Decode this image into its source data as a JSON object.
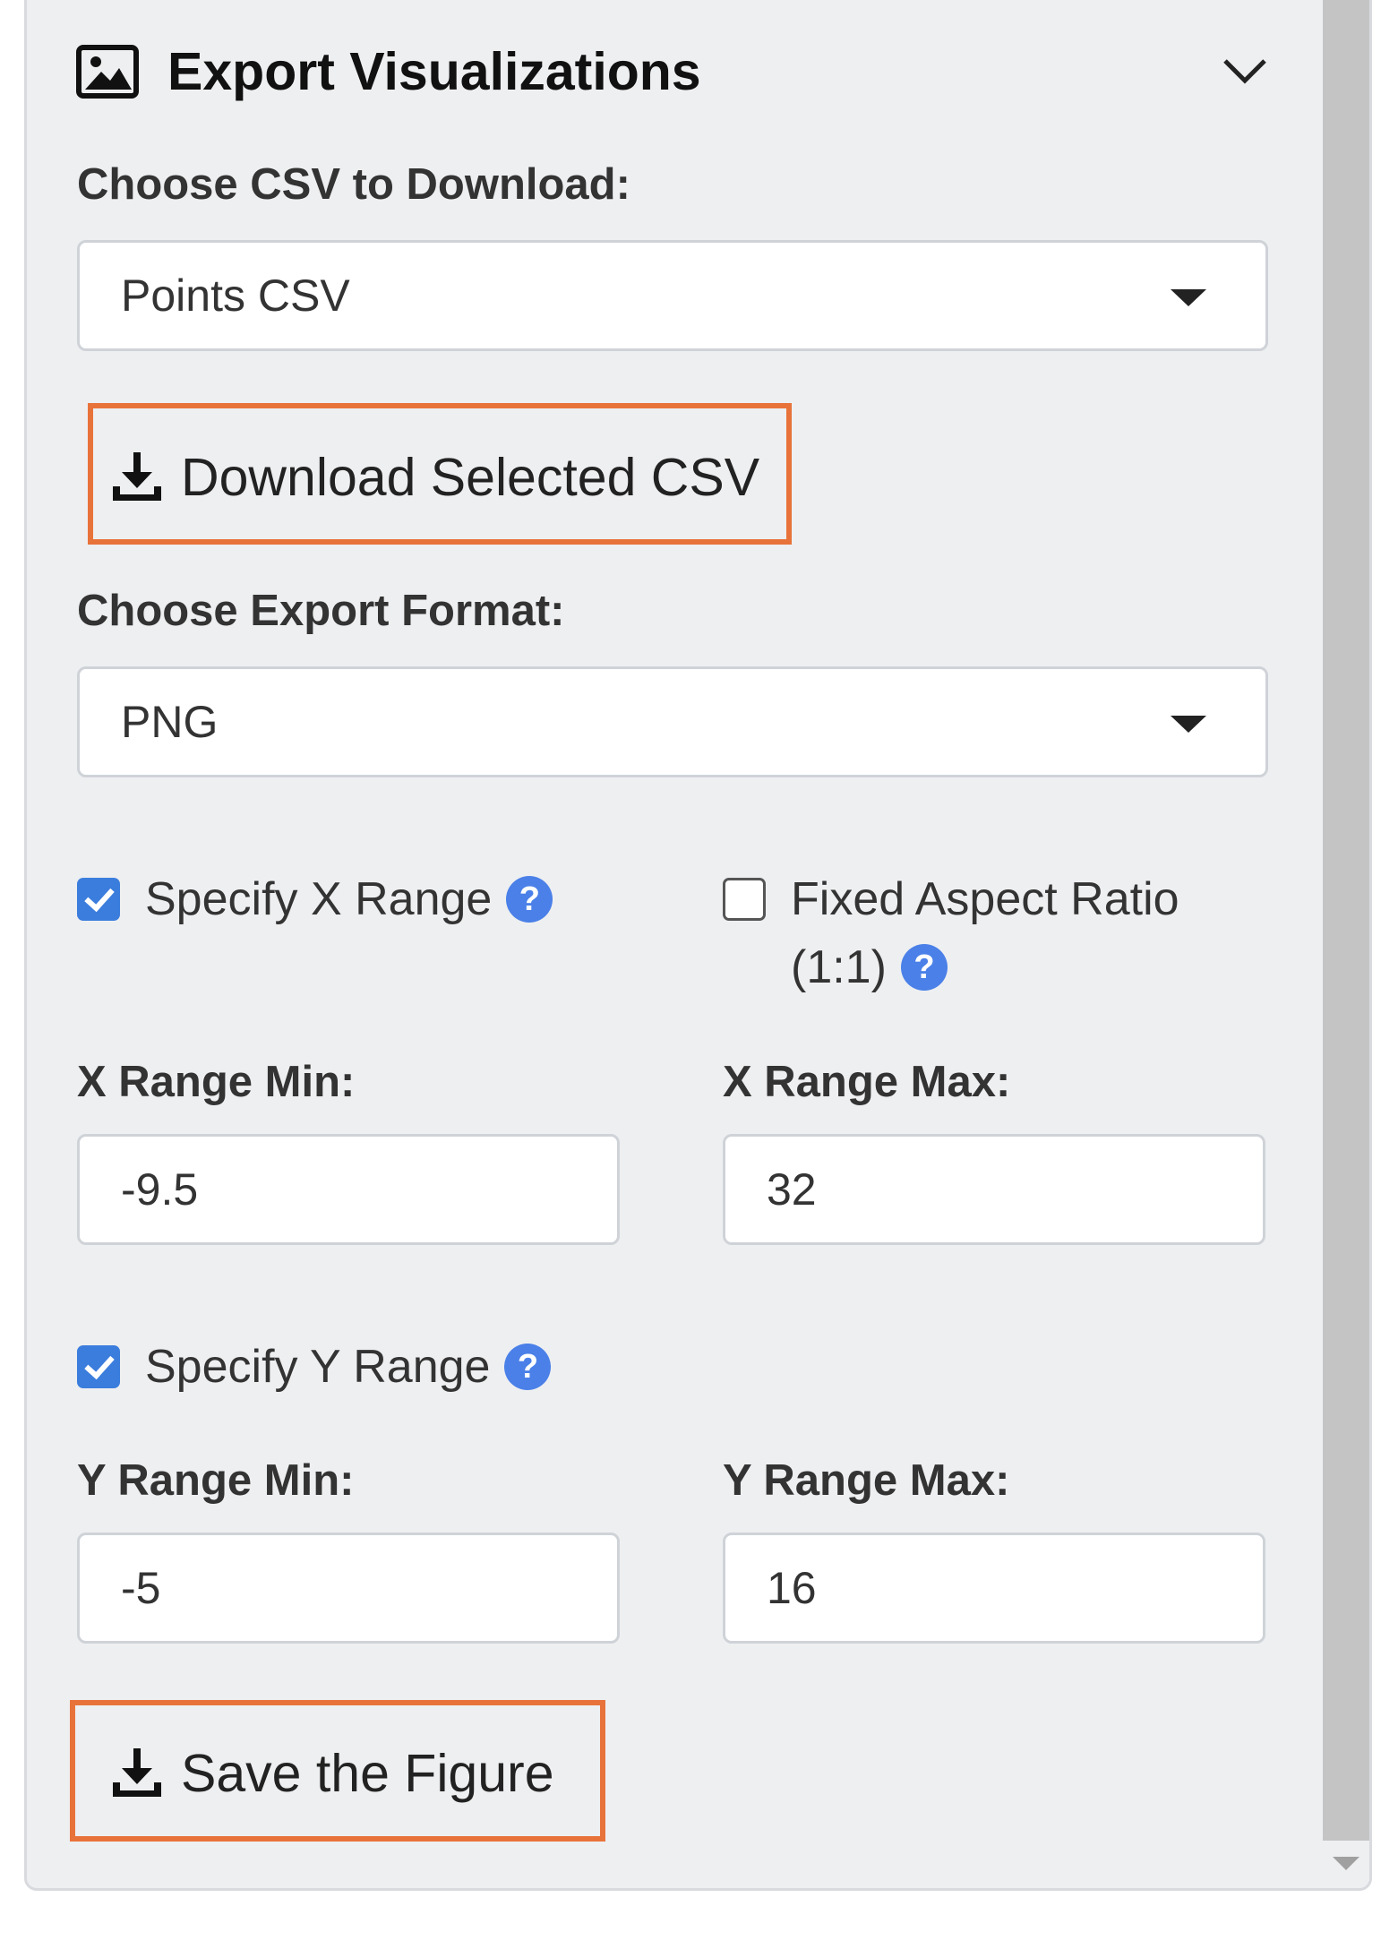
{
  "header": {
    "title": "Export Visualizations",
    "icon": "image-icon",
    "collapse_icon": "chevron-down-icon"
  },
  "csv": {
    "label": "Choose CSV to Download:",
    "selected": "Points CSV",
    "download_button": "Download Selected CSV"
  },
  "format": {
    "label": "Choose Export Format:",
    "selected": "PNG"
  },
  "x_range": {
    "specify_label": "Specify X Range",
    "specify_checked": true,
    "aspect_label_line1": "Fixed Aspect Ratio",
    "aspect_label_line2": "(1:1)",
    "aspect_checked": false,
    "min_label": "X Range Min:",
    "min_value": "-9.5",
    "max_label": "X Range Max:",
    "max_value": "32"
  },
  "y_range": {
    "specify_label": "Specify Y Range",
    "specify_checked": true,
    "min_label": "Y Range Min:",
    "min_value": "-5",
    "max_label": "Y Range Max:",
    "max_value": "16"
  },
  "save_button": "Save the Figure",
  "help_glyph": "?",
  "colors": {
    "accent_blue": "#3b7ddd",
    "highlight_orange": "#e8733a",
    "panel_bg": "#eeeff1"
  }
}
